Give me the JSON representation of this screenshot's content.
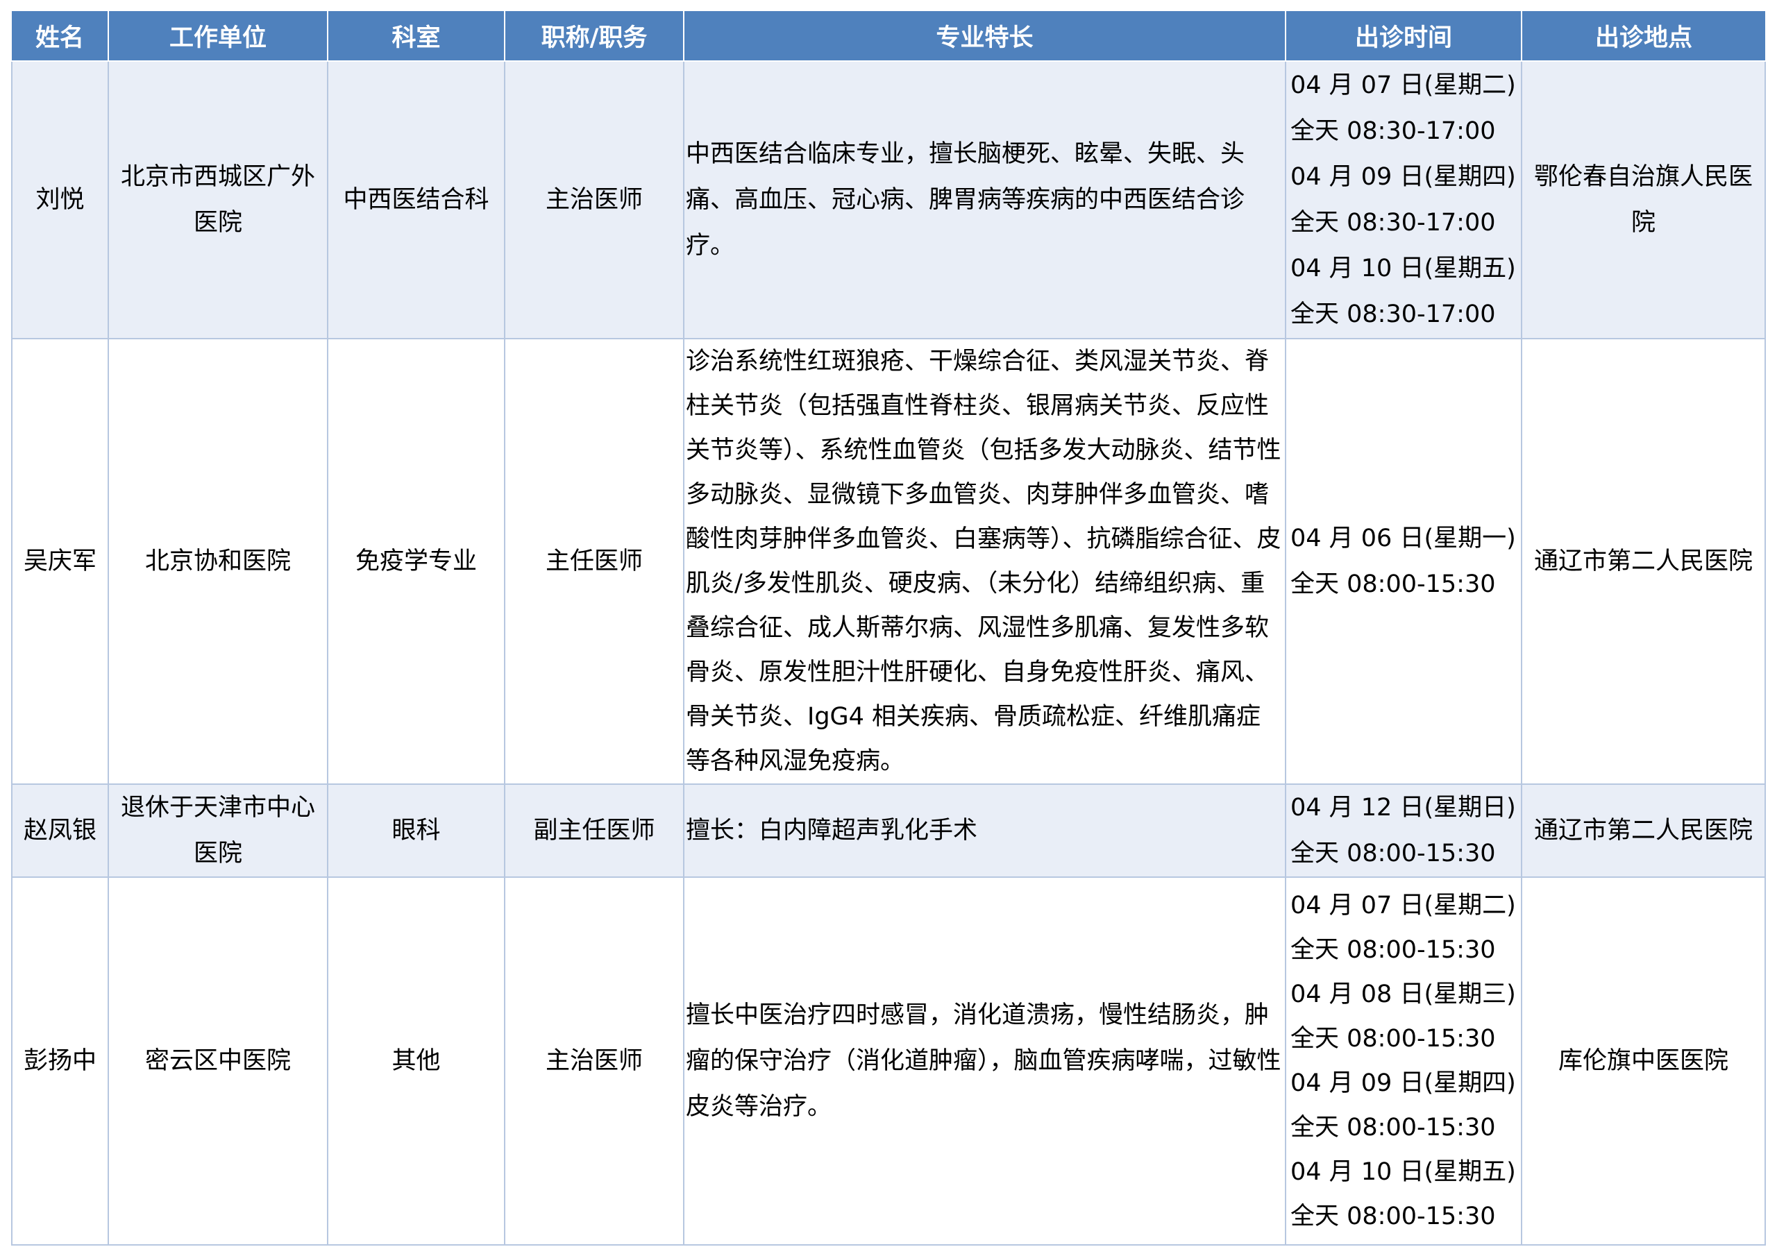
{
  "table": {
    "headers": [
      "姓名",
      "工作单位",
      "科室",
      "职称/职务",
      "专业特长",
      "出诊时间",
      "出诊地点"
    ],
    "rows": [
      {
        "name": "刘悦",
        "workplace": "北京市西城区广外医院",
        "department": "中西医结合科",
        "title": "主治医师",
        "specialty": "中西医结合临床专业，擅长脑梗死、眩晕、失眠、头痛、高血压、冠心病、脾胃病等疾病的中西医结合诊疗。",
        "schedule": [
          "04 月 07 日(星期二)",
          "全天 08:30-17:00",
          "04 月 09 日(星期四)",
          "全天 08:30-17:00",
          "04 月 10 日(星期五)",
          "全天 08:30-17:00"
        ],
        "location": "鄂伦春自治旗人民医院"
      },
      {
        "name": "吴庆军",
        "workplace": "北京协和医院",
        "department": "免疫学专业",
        "title": "主任医师",
        "specialty": "诊治系统性红斑狼疮、干燥综合征、类风湿关节炎、脊柱关节炎（包括强直性脊柱炎、银屑病关节炎、反应性关节炎等）、系统性血管炎（包括多发大动脉炎、结节性多动脉炎、显微镜下多血管炎、肉芽肿伴多血管炎、嗜酸性肉芽肿伴多血管炎、白塞病等）、抗磷脂综合征、皮肌炎/多发性肌炎、硬皮病、（未分化）结缔组织病、重叠综合征、成人斯蒂尔病、风湿性多肌痛、复发性多软骨炎、原发性胆汁性肝硬化、自身免疫性肝炎、痛风、骨关节炎、IgG4 相关疾病、骨质疏松症、纤维肌痛症等各种风湿免疫病。",
        "schedule": [
          "04 月 06 日(星期一)",
          "全天 08:00-15:30"
        ],
        "location": "通辽市第二人民医院"
      },
      {
        "name": "赵凤银",
        "workplace": "退休于天津市中心医院",
        "department": "眼科",
        "title": "副主任医师",
        "specialty": "擅长：白内障超声乳化手术",
        "schedule": [
          "04 月 12 日(星期日)",
          "全天 08:00-15:30"
        ],
        "location": "通辽市第二人民医院"
      },
      {
        "name": "彭扬中",
        "workplace": "密云区中医院",
        "department": "其他",
        "title": "主治医师",
        "specialty": "擅长中医治疗四时感冒，消化道溃疡，慢性结肠炎，肿瘤的保守治疗（消化道肿瘤），脑血管疾病哮喘，过敏性皮炎等治疗。",
        "schedule": [
          "04 月 07 日(星期二)",
          "全天 08:00-15:30",
          "04 月 08 日(星期三)",
          "全天 08:00-15:30",
          "04 月 09 日(星期四)",
          "全天 08:00-15:30",
          "04 月 10 日(星期五)",
          "全天 08:00-15:30"
        ],
        "location": "库伦旗中医医院"
      }
    ]
  }
}
